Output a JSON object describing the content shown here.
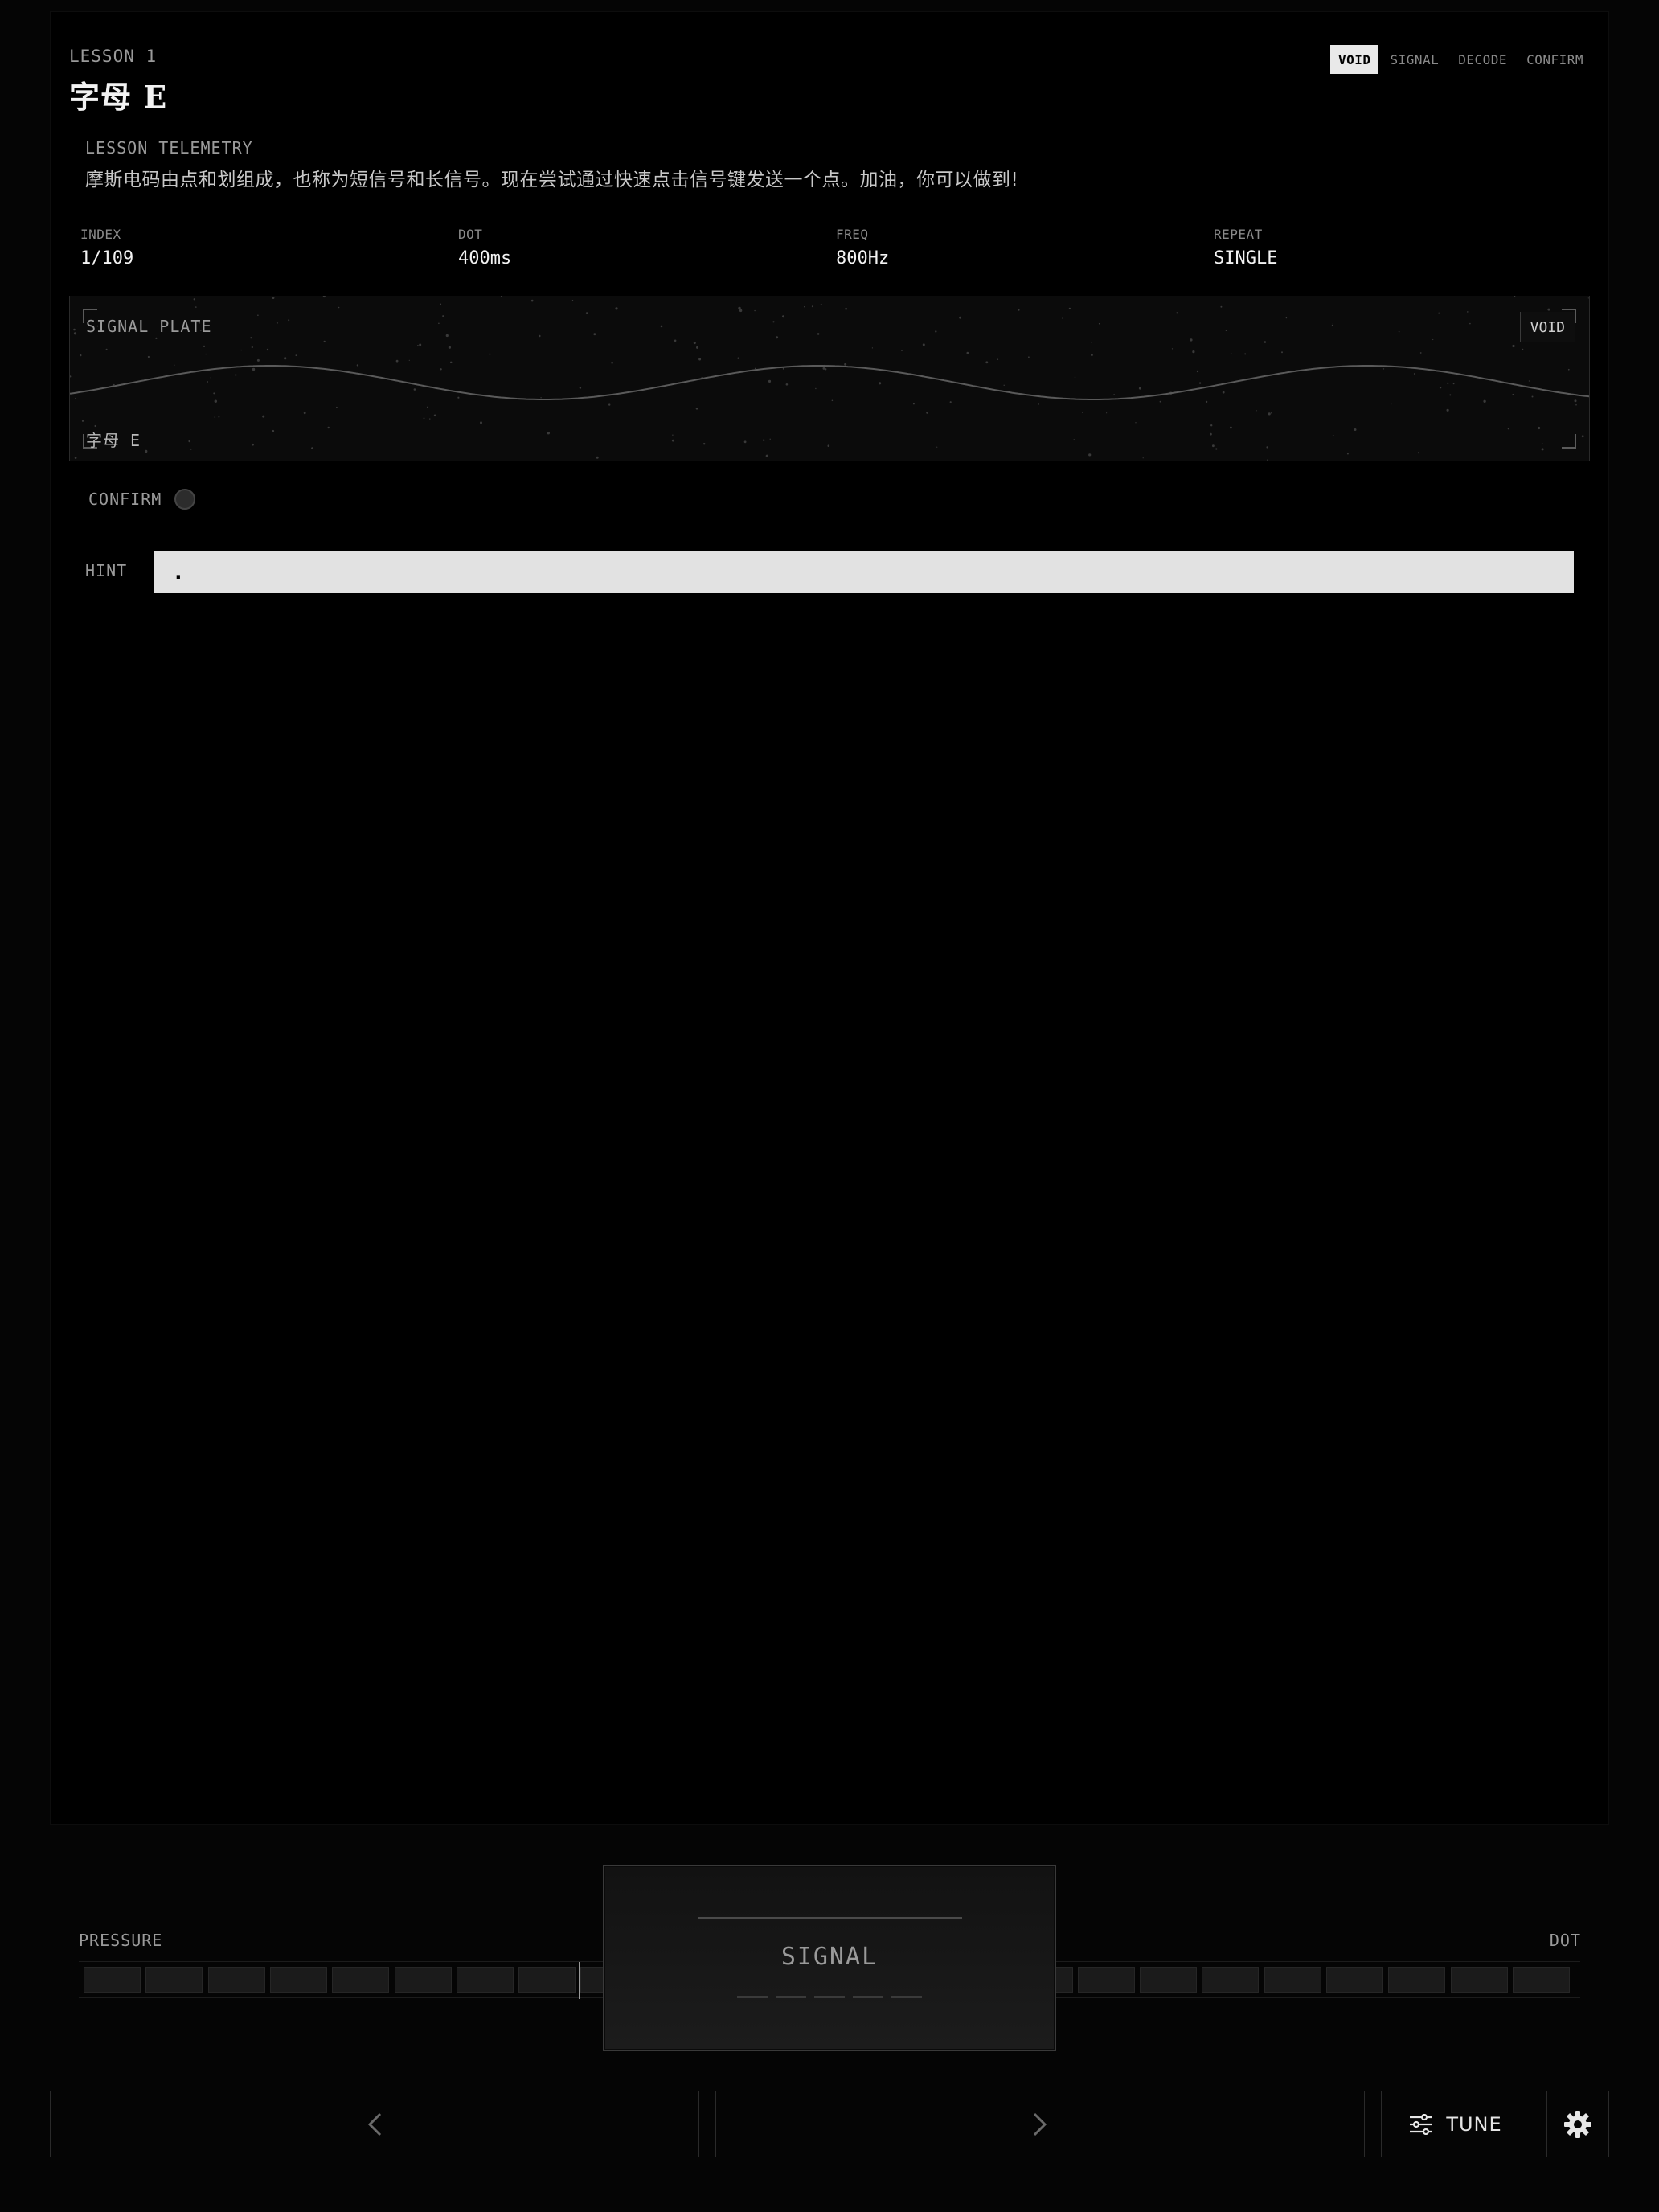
{
  "header": {
    "lesson_label": "LESSON 1",
    "title": "字母 E",
    "modes": [
      {
        "label": "VOID",
        "active": true
      },
      {
        "label": "SIGNAL",
        "active": false
      },
      {
        "label": "DECODE",
        "active": false
      },
      {
        "label": "CONFIRM",
        "active": false
      }
    ]
  },
  "telemetry": {
    "label": "LESSON TELEMETRY",
    "text": "摩斯电码由点和划组成，也称为短信号和长信号。现在尝试通过快速点击信号键发送一个点。加油，你可以做到!"
  },
  "stats": [
    {
      "key": "INDEX",
      "value": "1/109"
    },
    {
      "key": "DOT",
      "value": "400ms"
    },
    {
      "key": "FREQ",
      "value": "800Hz"
    },
    {
      "key": "REPEAT",
      "value": "SINGLE"
    }
  ],
  "plate": {
    "title": "SIGNAL PLATE",
    "mode": "VOID",
    "char": "字母 E"
  },
  "confirm": {
    "label": "CONFIRM"
  },
  "hint": {
    "label": "HINT",
    "value": "."
  },
  "pressure": {
    "label": "PRESSURE",
    "right_label": "DOT"
  },
  "signal_key": {
    "label": "SIGNAL"
  },
  "nav": {
    "tune_label": "TUNE"
  },
  "icons": {
    "prev": "chevron-left-icon",
    "next": "chevron-right-icon",
    "tune": "sliders-icon",
    "settings": "gear-icon"
  }
}
